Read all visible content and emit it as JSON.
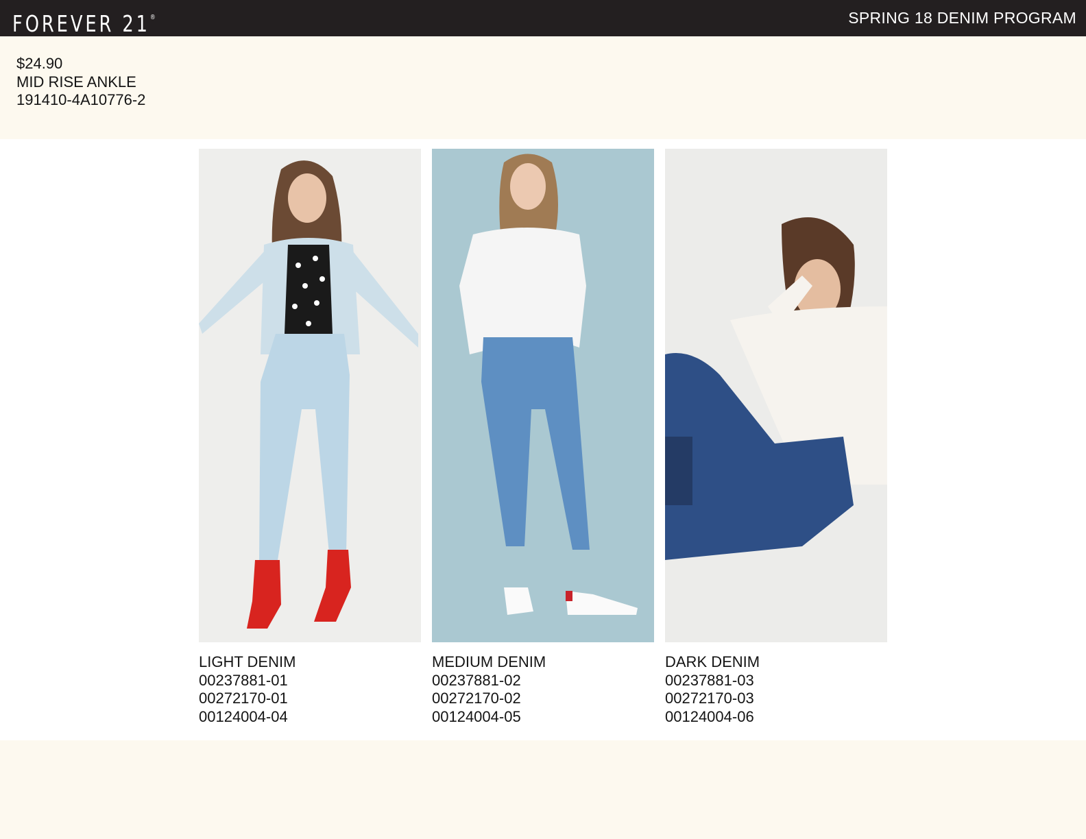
{
  "header": {
    "brand": "FOREVER 21",
    "brand_mark": "®",
    "program": "SPRING 18 DENIM PROGRAM"
  },
  "product": {
    "price": "$24.90",
    "style": "MID RISE ANKLE",
    "style_number": "191410-4A10776-2"
  },
  "colorways": [
    {
      "name": "LIGHT DENIM",
      "codes": [
        "00237881-01",
        "00272170-01",
        "00124004-04"
      ],
      "photo_bg": "#eeeeec",
      "denim": "#bcd6e6"
    },
    {
      "name": "MEDIUM DENIM",
      "codes": [
        "00237881-02",
        "00272170-02",
        "00124004-05"
      ],
      "photo_bg": "#aac8d1",
      "denim": "#5e8fc2"
    },
    {
      "name": "DARK DENIM",
      "codes": [
        "00237881-03",
        "00272170-03",
        "00124004-06"
      ],
      "photo_bg": "#ececea",
      "denim": "#2e4f86"
    }
  ],
  "colors": {
    "header_bg": "#231f20",
    "page_bg": "#fdf9ef",
    "panel_bg": "#ffffff"
  }
}
